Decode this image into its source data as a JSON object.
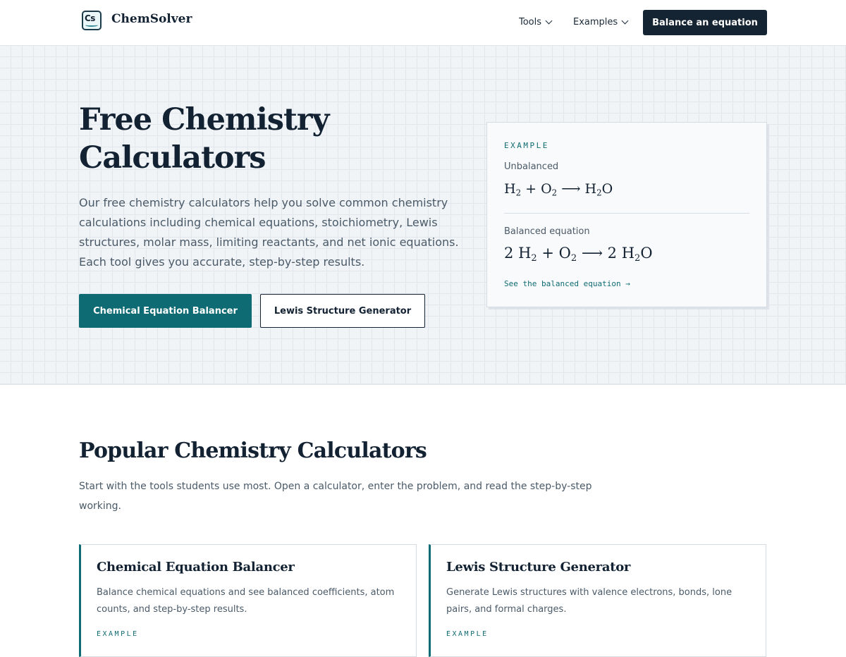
{
  "nav": {
    "logo_mark": "Cs",
    "brand": "ChemSolver",
    "links": [
      {
        "label": "Tools"
      },
      {
        "label": "Examples"
      }
    ],
    "cta": "Balance an equation"
  },
  "hero": {
    "title": "Free Chemistry Calculators",
    "description": "Our free chemistry calculators help you solve common chemistry calculations including chemical equations, stoichiometry, Lewis structures, molar mass, limiting reactants, and net ionic equations. Each tool gives you accurate, step-by-step results.",
    "primary_button": "Chemical Equation Balancer",
    "secondary_button": "Lewis Structure Generator"
  },
  "example": {
    "eyebrow": "EXAMPLE",
    "unbalanced_label": "Unbalanced",
    "unbalanced": {
      "r1": "H",
      "r1_sub": "2",
      "plus": "+",
      "r2": "O",
      "r2_sub": "2",
      "arrow": "⟶",
      "p1": "H",
      "p1_sub": "2",
      "p1_tail": "O"
    },
    "balanced_label": "Balanced equation",
    "balanced": {
      "c1": "2",
      "r1": "H",
      "r1_sub": "2",
      "plus": "+",
      "r2": "O",
      "r2_sub": "2",
      "arrow": "⟶",
      "c2": "2",
      "p1": "H",
      "p1_sub": "2",
      "p1_tail": "O"
    },
    "link": "See the balanced equation →"
  },
  "popular": {
    "title": "Popular Chemistry Calculators",
    "description": "Start with the tools students use most. Open a calculator, enter the problem, and read the step-by-step working.",
    "cards": [
      {
        "title": "Chemical Equation Balancer",
        "description": "Balance chemical equations and see balanced coefficients, atom counts, and step-by-step results.",
        "eyebrow": "EXAMPLE"
      },
      {
        "title": "Lewis Structure Generator",
        "description": "Generate Lewis structures with valence electrons, bonds, lone pairs, and formal charges.",
        "eyebrow": "EXAMPLE"
      }
    ]
  },
  "colors": {
    "accent": "#0f6b73",
    "ink": "#132233",
    "muted": "#4a5a68",
    "hero_bg": "#f1f4f6"
  },
  "icons": {
    "logo": "periodic-element-icon",
    "dropdown": "chevron-down-icon"
  }
}
